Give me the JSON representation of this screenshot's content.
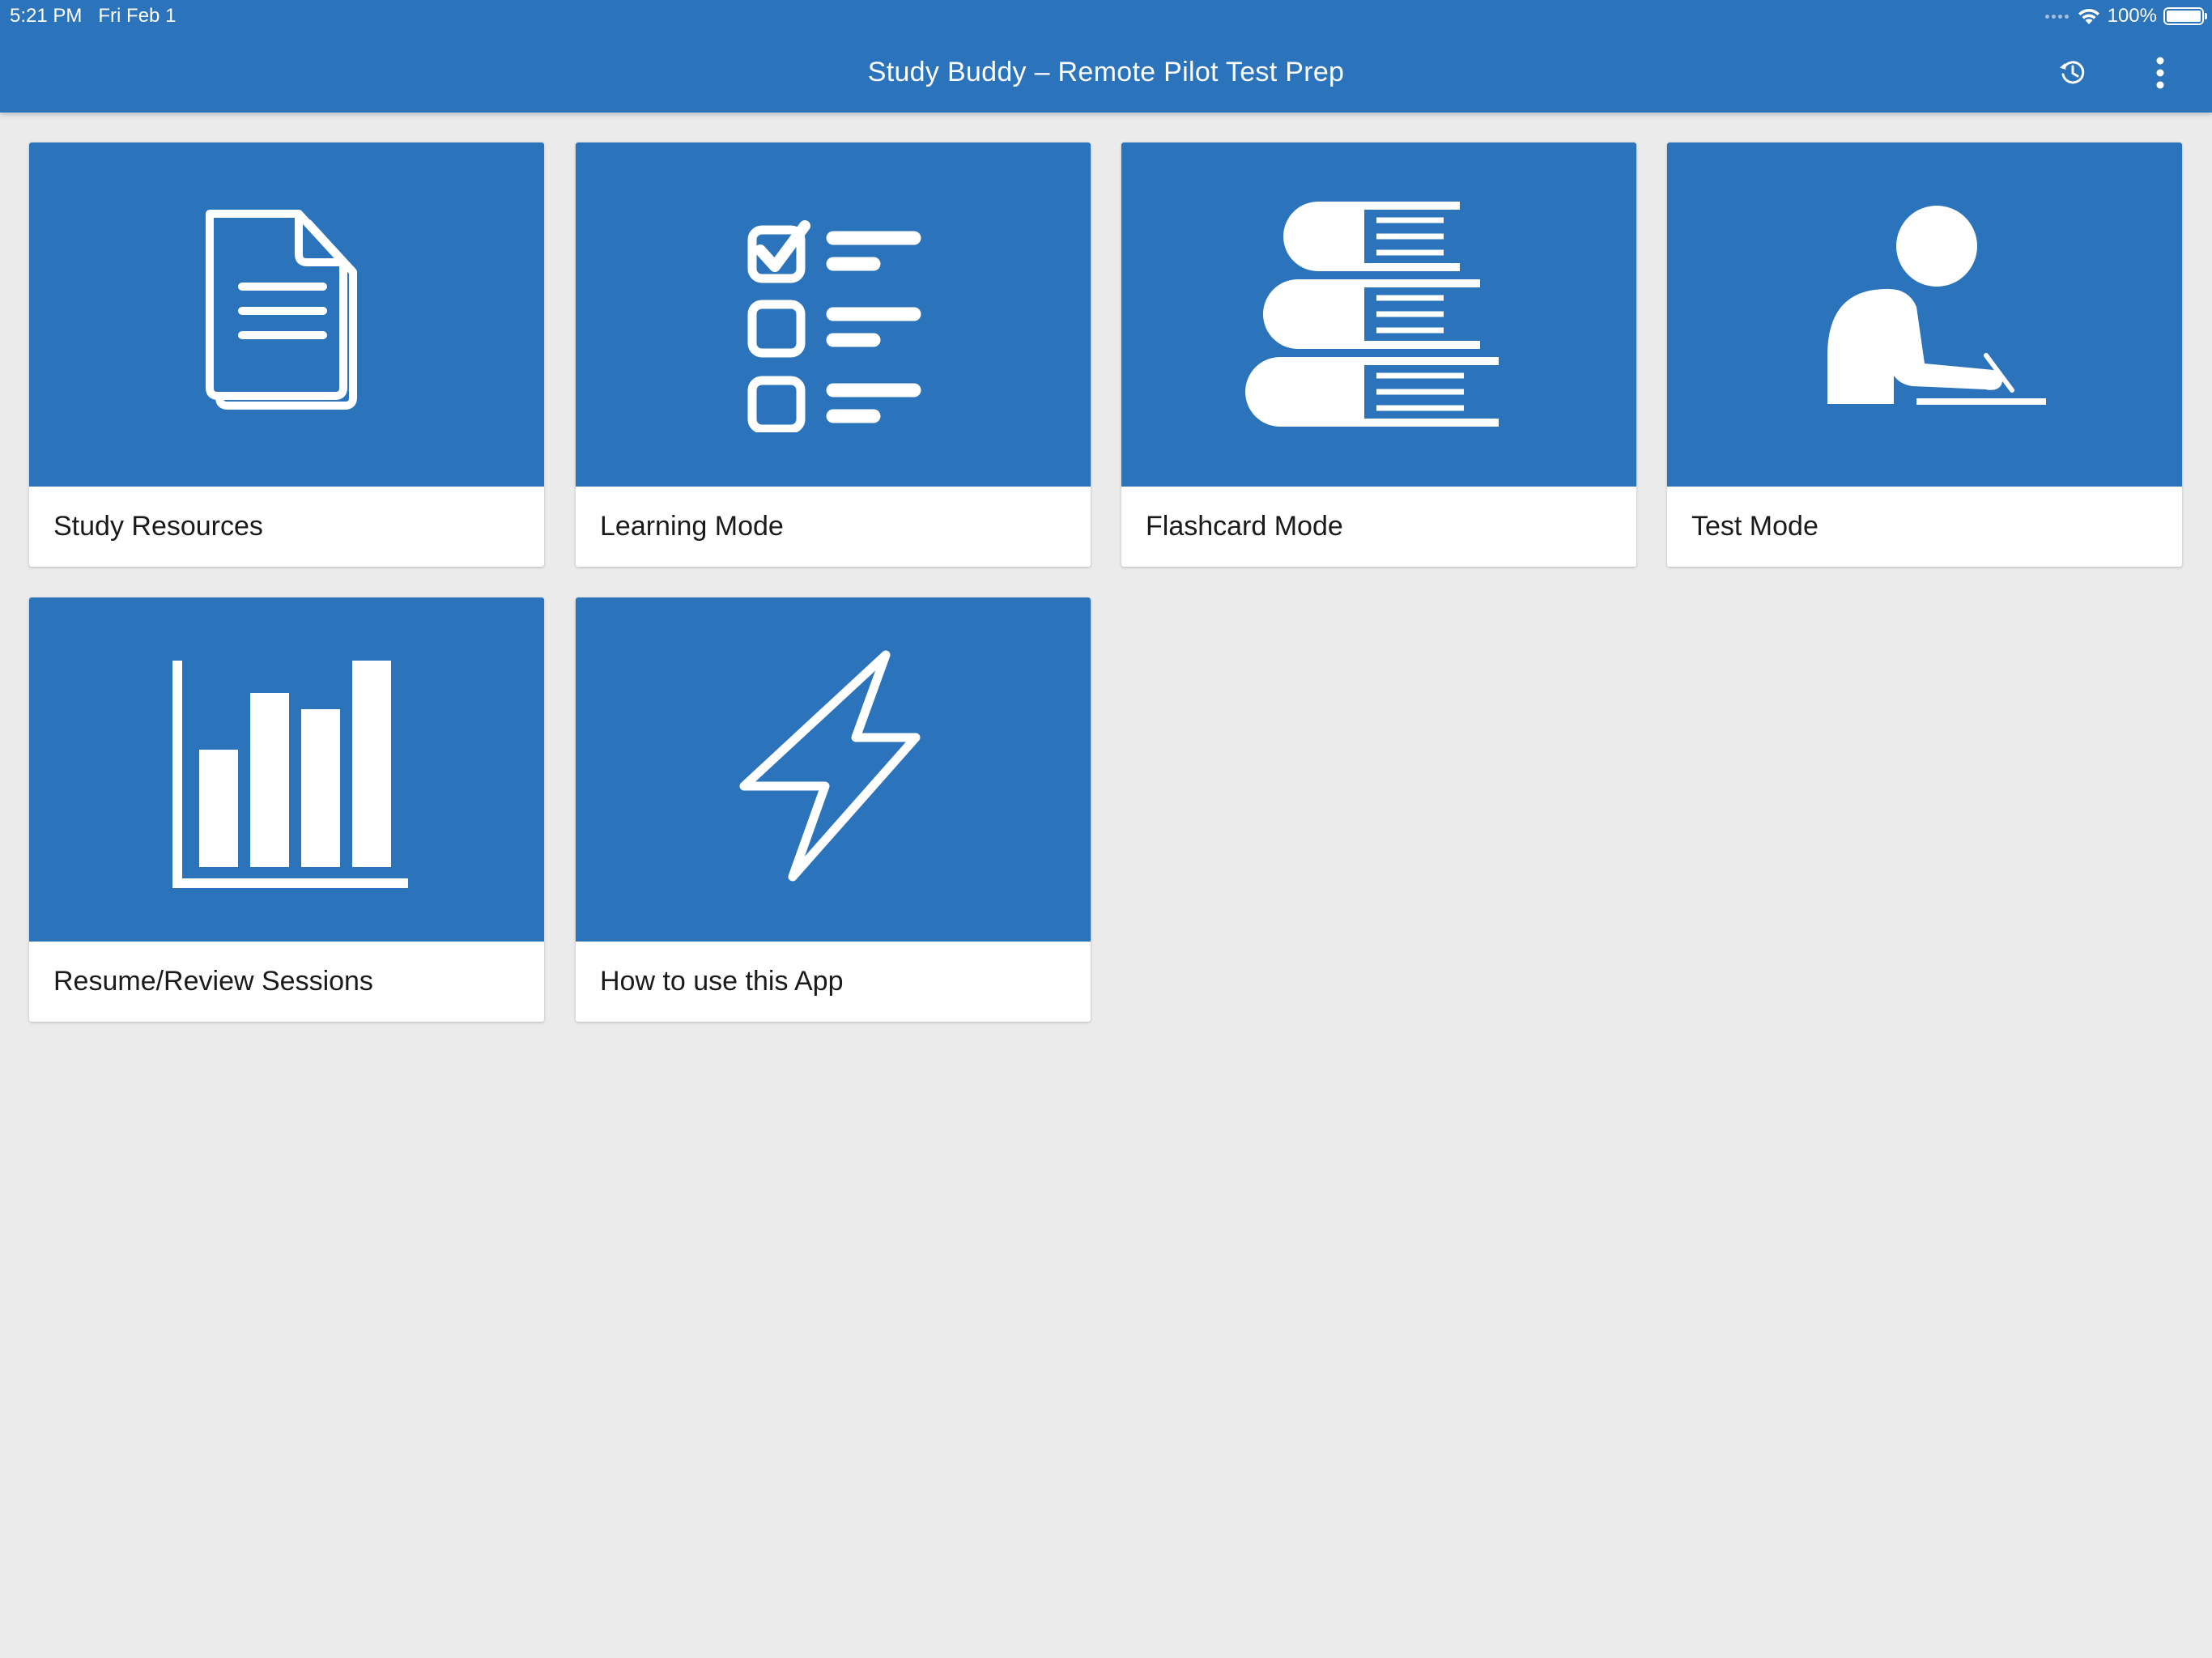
{
  "status_bar": {
    "time": "5:21 PM",
    "date": "Fri Feb 1",
    "battery": "100%",
    "icons": [
      "signal-dots-icon",
      "wifi-icon",
      "battery-icon"
    ]
  },
  "header": {
    "title": "Study Buddy – Remote Pilot Test Prep",
    "actions": [
      {
        "icon": "history-icon"
      },
      {
        "icon": "more-vertical-icon"
      }
    ]
  },
  "tiles": [
    {
      "label": "Study Resources",
      "icon": "document-icon"
    },
    {
      "label": "Learning Mode",
      "icon": "checklist-icon"
    },
    {
      "label": "Flashcard Mode",
      "icon": "books-stack-icon"
    },
    {
      "label": "Test Mode",
      "icon": "person-writing-icon"
    },
    {
      "label": "Resume/Review Sessions",
      "icon": "bar-chart-icon"
    },
    {
      "label": "How to use this App",
      "icon": "lightning-bolt-icon"
    }
  ],
  "colors": {
    "accent": "#2b73bb",
    "background": "#ebebeb",
    "card": "#ffffff",
    "text": "#1a1a1a"
  }
}
